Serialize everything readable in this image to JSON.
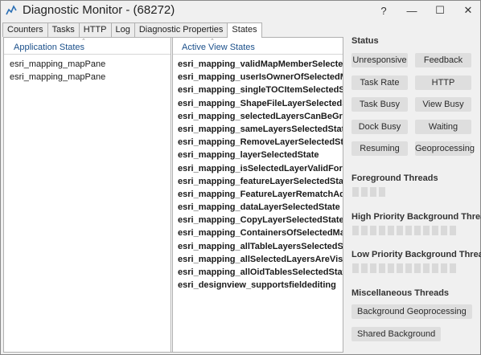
{
  "window": {
    "title": "Diagnostic Monitor - (68272)",
    "help_label": "?",
    "min_label": "—",
    "max_label": "☐",
    "close_label": "✕"
  },
  "tabs": [
    {
      "label": "Counters"
    },
    {
      "label": "Tasks"
    },
    {
      "label": "HTTP"
    },
    {
      "label": "Log"
    },
    {
      "label": "Diagnostic Properties"
    },
    {
      "label": "States"
    }
  ],
  "active_tab": "States",
  "app_states": {
    "header": "Application States",
    "items": [
      "esri_mapping_mapPane",
      "esri_mapping_mapPane"
    ]
  },
  "view_states": {
    "header": "Active View States",
    "items": [
      "esri_mapping_validMapMemberSelectedSt",
      "esri_mapping_userIsOwnerOfSelectedMap",
      "esri_mapping_singleTOCItemSelectedState",
      "esri_mapping_ShapeFileLayerSelectedState",
      "esri_mapping_selectedLayersCanBeGroupe",
      "esri_mapping_sameLayersSelectedState",
      "esri_mapping_RemoveLayerSelectedState",
      "esri_mapping_layerSelectedState",
      "esri_mapping_isSelectedLayerValidForFloo",
      "esri_mapping_featureLayerSelectedState",
      "esri_mapping_FeatureLayerRematchAddre",
      "esri_mapping_dataLayerSelectedState",
      "esri_mapping_CopyLayerSelectedState",
      "esri_mapping_ContainersOfSelectedMapM",
      "esri_mapping_allTableLayersSelectedState",
      "esri_mapping_allSelectedLayersAreVisible",
      "esri_mapping_allOidTablesSelectedState",
      "esri_designview_supportsfieldediting"
    ]
  },
  "status": {
    "title": "Status",
    "buttons": [
      [
        "Unresponsive",
        "Feedback"
      ],
      [
        "Task Rate",
        "HTTP"
      ],
      [
        "Task Busy",
        "View Busy"
      ],
      [
        "Dock Busy",
        "Waiting"
      ],
      [
        "Resuming",
        "Geoprocessing"
      ]
    ]
  },
  "threads": {
    "foreground": {
      "title": "Foreground Threads",
      "count": 4
    },
    "high": {
      "title": "High Priority Background Threads",
      "count": 12
    },
    "low": {
      "title": "Low Priority Background Threads",
      "count": 12
    }
  },
  "misc": {
    "title": "Miscellaneous Threads",
    "buttons": [
      "Background Geoprocessing",
      "Shared Background"
    ]
  },
  "colors": {
    "accent_header": "#1a4f8a",
    "button_bg": "#dedede",
    "thread_cell": "#d9d9d9"
  }
}
